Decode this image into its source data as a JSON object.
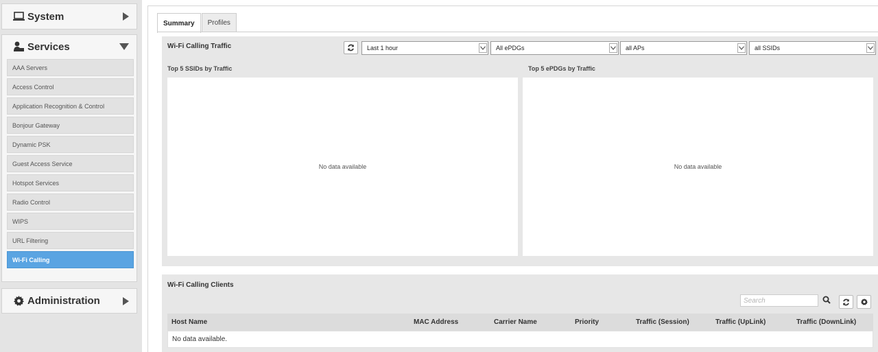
{
  "sidebar": {
    "system": {
      "label": "System"
    },
    "services": {
      "label": "Services",
      "items": [
        {
          "label": "AAA Servers"
        },
        {
          "label": "Access Control"
        },
        {
          "label": "Application Recognition & Control"
        },
        {
          "label": "Bonjour Gateway"
        },
        {
          "label": "Dynamic PSK"
        },
        {
          "label": "Guest Access Service"
        },
        {
          "label": "Hotspot Services"
        },
        {
          "label": "Radio Control"
        },
        {
          "label": "WIPS"
        },
        {
          "label": "URL Filtering"
        },
        {
          "label": "Wi-Fi Calling"
        }
      ],
      "active_item": "Wi-Fi Calling"
    },
    "administration": {
      "label": "Administration"
    }
  },
  "tabs": [
    {
      "label": "Summary",
      "active": true
    },
    {
      "label": "Profiles",
      "active": false
    }
  ],
  "traffic": {
    "title": "Wi-Fi Calling Traffic",
    "filters": {
      "time": "Last 1 hour",
      "epdgs": "All ePDGs",
      "aps": "all APs",
      "ssids": "all SSIDs"
    },
    "charts": [
      {
        "title": "Top 5 SSIDs by Traffic",
        "empty_text": "No data available"
      },
      {
        "title": "Top 5 ePDGs by Traffic",
        "empty_text": "No data available"
      }
    ]
  },
  "clients": {
    "title": "Wi-Fi Calling Clients",
    "search_placeholder": "Search",
    "columns": [
      "Host Name",
      "MAC Address",
      "Carrier Name",
      "Priority",
      "Traffic (Session)",
      "Traffic (UpLink)",
      "Traffic (DownLink)"
    ],
    "empty_text": "No data available."
  },
  "colors": {
    "active_item": "#5aa4e2",
    "panel_bg": "#e7e7e7",
    "sidebar_bg": "#e4e4e4"
  }
}
